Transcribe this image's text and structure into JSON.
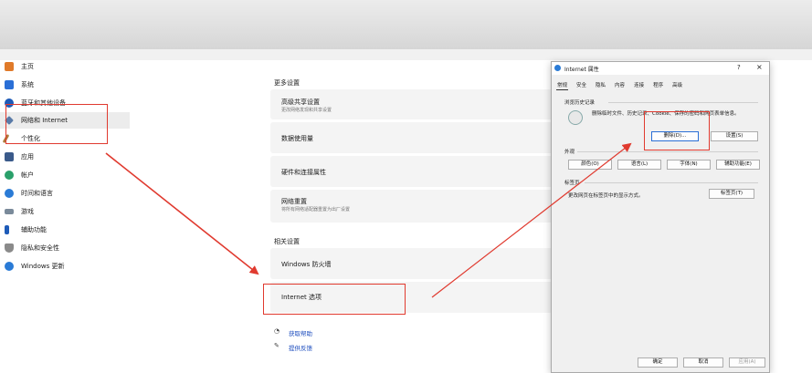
{
  "sidebar": {
    "items": [
      {
        "label": "主页",
        "icon": "home-icon",
        "color": "#e07a2a"
      },
      {
        "label": "系统",
        "icon": "system-icon",
        "color": "#2a6fd6"
      },
      {
        "label": "蓝牙和其他设备",
        "icon": "bluetooth-icon",
        "color": "#1e5bb8"
      },
      {
        "label": "网络和 Internet",
        "icon": "network-icon",
        "color": "#5a7ba8"
      },
      {
        "label": "个性化",
        "icon": "personalization-icon",
        "color": "#b07a3a"
      },
      {
        "label": "应用",
        "icon": "apps-icon",
        "color": "#3a5a8a"
      },
      {
        "label": "帐户",
        "icon": "account-icon",
        "color": "#2aa06a"
      },
      {
        "label": "时间和语言",
        "icon": "time-language-icon",
        "color": "#2a7bd6"
      },
      {
        "label": "游戏",
        "icon": "gaming-icon",
        "color": "#7a8a9a"
      },
      {
        "label": "辅助功能",
        "icon": "accessibility-icon",
        "color": "#1e5bb8"
      },
      {
        "label": "隐私和安全性",
        "icon": "privacy-icon",
        "color": "#8a8a8a"
      },
      {
        "label": "Windows 更新",
        "icon": "windows-update-icon",
        "color": "#2a7bd6"
      }
    ]
  },
  "main": {
    "more_settings": "更多设置",
    "cards": [
      {
        "title": "高级共享设置",
        "subtitle": "更改网络发现和共享设置"
      },
      {
        "title": "数据使用量",
        "subtitle": ""
      },
      {
        "title": "硬件和连接属性",
        "subtitle": ""
      },
      {
        "title": "网络重置",
        "subtitle": "将所有网络适配器重置为出厂设置"
      }
    ],
    "related_settings": "相关设置",
    "related": [
      {
        "title": "Windows 防火墙"
      },
      {
        "title": "Internet 选项"
      }
    ],
    "links": [
      {
        "label": "获取帮助",
        "icon": "help-icon"
      },
      {
        "label": "提供反馈",
        "icon": "feedback-icon"
      }
    ]
  },
  "dialog": {
    "title": "Internet 属性",
    "help": "?",
    "close": "×",
    "tabs": [
      "常规",
      "安全",
      "隐私",
      "内容",
      "连接",
      "程序",
      "高级"
    ],
    "history_group": "浏览历史记录",
    "history_desc": "删除临时文件、历史记录、Cookie、保存的密码和网页表单信息。",
    "delete_btn": "删除(D)...",
    "settings_btn": "设置(S)",
    "appearance_group": "外观",
    "appearance_btns": [
      "颜色(O)",
      "语言(L)",
      "字体(N)",
      "辅助功能(E)"
    ],
    "tabs_group": "标签页",
    "tabs_desc": "更改网页在标签页中的显示方式。",
    "tabs_btn": "标签页(T)",
    "ok": "确定",
    "cancel": "取消",
    "apply": "应用(A)"
  },
  "accent_color": "#e03a2f"
}
